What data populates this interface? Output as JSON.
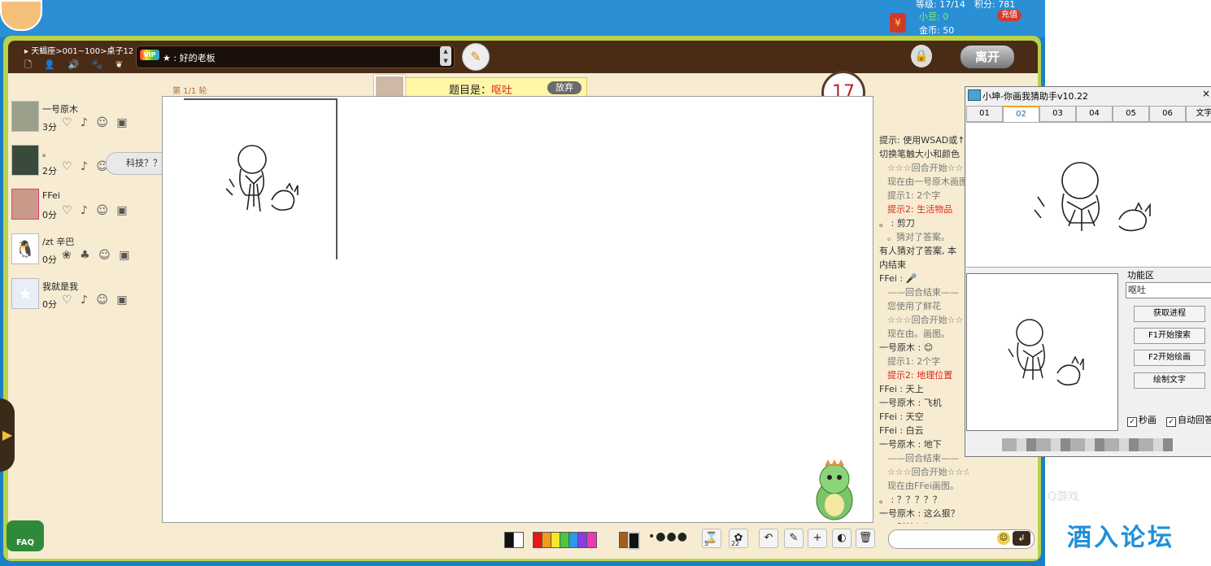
{
  "colors": {
    "frame": "#b9d24a",
    "header": "#4a2c16",
    "cream": "#f7ecd2",
    "accent_red": "#e0261c",
    "forum_blue": "#1e90d8"
  },
  "top": {
    "rank": "等级: 17/14",
    "points": "积分: 781",
    "beans_label": "小豆: 0",
    "coins": "金币: 50",
    "recharge": "充值",
    "red_bag": "¥"
  },
  "header": {
    "room_path": "▸ 天蝎座>001~100>桌子12",
    "icons": "🗋 👤 🔊 🐾 ❦",
    "vip": "VIP",
    "chat_prefix": "★ :",
    "chat_text": "好的老板",
    "leave": "离开"
  },
  "players": [
    {
      "name": "一号原木",
      "score": "3分",
      "icons": "♡ ♪ ☺ ▣"
    },
    {
      "name": "。",
      "score": "2分",
      "icons": "♡ ♪ ☺"
    },
    {
      "name": "FFei",
      "score": "0分",
      "icons": "♡ ♪ ☺ ▣"
    },
    {
      "name": "/zt 辛巴",
      "score": "0分",
      "icons": "❀ ♣ ☺ ▣"
    },
    {
      "name": "我就是我",
      "score": "0分",
      "icons": "♡ ♪ ☺ ▣"
    }
  ],
  "bubble": "科技？？",
  "round": "第 1/1 轮",
  "topic": {
    "prefix": "题目是：",
    "answer": "呕吐",
    "give_up": "放弃"
  },
  "timer": "17",
  "chat_log": [
    {
      "t": "提示: 使用WSAD或↑",
      "cls": ""
    },
    {
      "t": "切换笔触大小和颜色",
      "cls": ""
    },
    {
      "t": "☆☆☆回合开始☆☆",
      "cls": "sys"
    },
    {
      "t": "现在由一号原木画图",
      "cls": "sys"
    },
    {
      "t": "提示1: 2个字",
      "cls": "sys"
    },
    {
      "t": "提示2: 生活物品",
      "cls": "sys",
      "hl": true
    },
    {
      "t": "。 : 剪刀",
      "cls": ""
    },
    {
      "t": "。猜对了答案。",
      "cls": "sys"
    },
    {
      "t": "有人猜对了答案, 本",
      "cls": ""
    },
    {
      "t": "内结束",
      "cls": ""
    },
    {
      "t": "FFei : 🎤",
      "cls": ""
    },
    {
      "t": "——回合结束——",
      "cls": "sys"
    },
    {
      "t": "您使用了鲜花",
      "cls": "sys"
    },
    {
      "t": "☆☆☆回合开始☆☆",
      "cls": "sys"
    },
    {
      "t": "现在由。画图。",
      "cls": "sys"
    },
    {
      "t": "一号原木 : 😊",
      "cls": ""
    },
    {
      "t": "提示1: 2个字",
      "cls": "sys"
    },
    {
      "t": "提示2: 地理位置",
      "cls": "sys",
      "hl": true
    },
    {
      "t": "FFei : 天上",
      "cls": ""
    },
    {
      "t": "一号原木 : 飞机",
      "cls": ""
    },
    {
      "t": "FFei : 天空",
      "cls": ""
    },
    {
      "t": "FFei : 白云",
      "cls": ""
    },
    {
      "t": "一号原木 : 地下",
      "cls": ""
    },
    {
      "t": "——回合结束——",
      "cls": "sys"
    },
    {
      "t": "☆☆☆回合开始☆☆☆",
      "cls": "sys"
    },
    {
      "t": "现在由FFei画图。",
      "cls": "sys"
    },
    {
      "t": "。 : ？？？？？",
      "cls": ""
    },
    {
      "t": "一号原木 : 这么狠？",
      "cls": ""
    },
    {
      "t": "。 : 科技？？",
      "cls": ""
    }
  ],
  "toolbar": {
    "colors": [
      "#111111",
      "#ffffff",
      "#e81818",
      "#f39a18",
      "#f4e82a",
      "#48c83a",
      "#2a9ae8",
      "#8a3ae8",
      "#e83ab8",
      "#a0601a"
    ],
    "dots": "•●●●",
    "undo": "↶",
    "pen": "✎",
    "plus": "+",
    "eraser": "◐",
    "trash": "🗑",
    "badge1": "5",
    "badge2": "22"
  },
  "faq": "FAQ",
  "helper": {
    "title": "小坤-你画我猜助手v10.22",
    "close": "×",
    "tabs": [
      "01",
      "02",
      "03",
      "04",
      "05",
      "06",
      "文字"
    ],
    "active_tab": 1,
    "func_label": "功能区",
    "func_value": "呕吐",
    "buttons": [
      "获取进程",
      "F1开始搜索",
      "F2开始绘画",
      "绘制文字"
    ],
    "check1": "秒画",
    "check2": "自动回答"
  },
  "forum": "酒入论坛",
  "qq_watermark": "Q游戏"
}
